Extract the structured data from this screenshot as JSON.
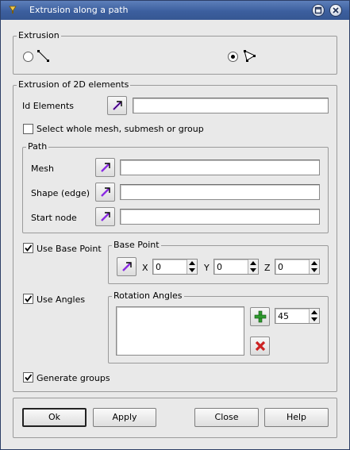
{
  "window": {
    "title": "Extrusion along a path"
  },
  "extrusion": {
    "legend": "Extrusion",
    "options": [
      {
        "name": "1D",
        "selected": false
      },
      {
        "name": "2D",
        "selected": true
      }
    ]
  },
  "elements": {
    "legend": "Extrusion of 2D elements",
    "id_label": "Id Elements",
    "id_value": "",
    "select_whole_label": "Select whole mesh, submesh or group",
    "select_whole_checked": false
  },
  "path": {
    "legend": "Path",
    "mesh_label": "Mesh",
    "mesh_value": "",
    "shape_label": "Shape (edge)",
    "shape_value": "",
    "start_node_label": "Start node",
    "start_node_value": ""
  },
  "base_point": {
    "use_label": "Use Base Point",
    "use_checked": true,
    "legend": "Base Point",
    "x_label": "X",
    "x_value": "0",
    "y_label": "Y",
    "y_value": "0",
    "z_label": "Z",
    "z_value": "0"
  },
  "angles": {
    "use_label": "Use Angles",
    "use_checked": true,
    "legend": "Rotation Angles",
    "angle_value": "45"
  },
  "generate_groups": {
    "label": "Generate groups",
    "checked": true
  },
  "buttons": {
    "ok": "Ok",
    "apply": "Apply",
    "close": "Close",
    "help": "Help"
  },
  "colors": {
    "titlebar": "#3c5f9e",
    "add_icon": "#2e9a2e",
    "remove_icon": "#cc2222",
    "pick_icon": "#8a2be2"
  }
}
